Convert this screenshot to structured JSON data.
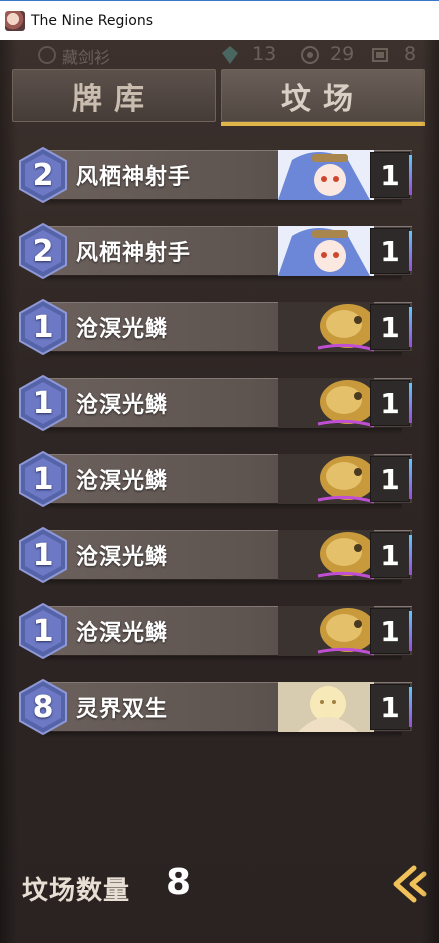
{
  "window": {
    "title": "The Nine Regions"
  },
  "topbar": {
    "player_name": "藏剑衫",
    "resource_a": "13",
    "resource_b": "29",
    "resource_c": "8"
  },
  "tabs": [
    {
      "label": "牌库",
      "active": false
    },
    {
      "label": "坟场",
      "active": true
    }
  ],
  "cards": [
    {
      "cost": "2",
      "name": "风栖神射手",
      "count": "1",
      "art": "blue-haired-girl"
    },
    {
      "cost": "2",
      "name": "风栖神射手",
      "count": "1",
      "art": "blue-haired-girl"
    },
    {
      "cost": "1",
      "name": "沧溟光鳞",
      "count": "1",
      "art": "golden-fish"
    },
    {
      "cost": "1",
      "name": "沧溟光鳞",
      "count": "1",
      "art": "golden-fish"
    },
    {
      "cost": "1",
      "name": "沧溟光鳞",
      "count": "1",
      "art": "golden-fish"
    },
    {
      "cost": "1",
      "name": "沧溟光鳞",
      "count": "1",
      "art": "golden-fish"
    },
    {
      "cost": "1",
      "name": "沧溟光鳞",
      "count": "1",
      "art": "golden-fish"
    },
    {
      "cost": "8",
      "name": "灵界双生",
      "count": "1",
      "art": "glowing-twins"
    }
  ],
  "footer": {
    "label": "坟场数量",
    "count": "8",
    "back_icon": "back-arrow-icon"
  },
  "colors": {
    "tab_underline": "#e0b54a",
    "cost_hex": "#6d79c4",
    "count_edge_top": "#5ec8ff",
    "count_edge_bottom": "#9a4bd6"
  }
}
